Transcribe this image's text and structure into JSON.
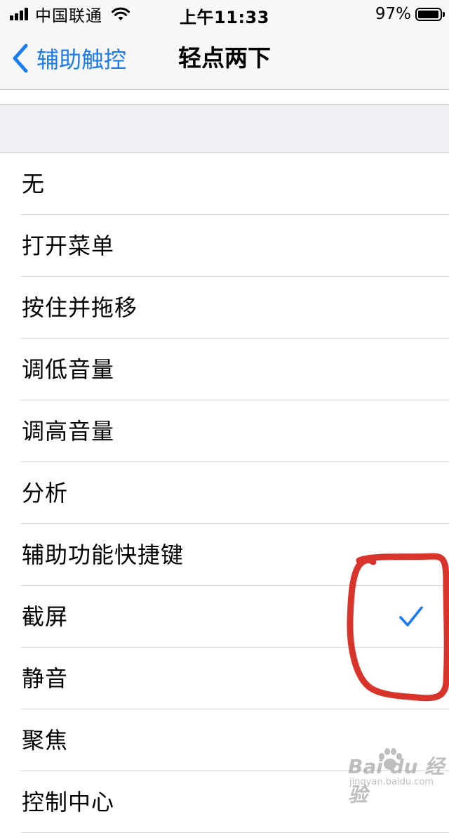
{
  "status_bar": {
    "carrier": "中国联通",
    "time": "上午11:33",
    "battery_percent": "97%",
    "battery_level": 0.97,
    "signal_bars": 4,
    "wifi_icon": "wifi-icon"
  },
  "nav": {
    "back_label": "辅助触控",
    "title": "轻点两下",
    "back_icon": "chevron-left-icon"
  },
  "options": [
    {
      "label": "无",
      "selected": false
    },
    {
      "label": "打开菜单",
      "selected": false
    },
    {
      "label": "按住并拖移",
      "selected": false
    },
    {
      "label": "调低音量",
      "selected": false
    },
    {
      "label": "调高音量",
      "selected": false
    },
    {
      "label": "分析",
      "selected": false
    },
    {
      "label": "辅助功能快捷键",
      "selected": false
    },
    {
      "label": "截屏",
      "selected": true
    },
    {
      "label": "静音",
      "selected": false
    },
    {
      "label": "聚焦",
      "selected": false
    },
    {
      "label": "控制中心",
      "selected": false
    }
  ],
  "selected_icon": "checkmark-icon",
  "watermark": {
    "main": "Bai du 经验",
    "sub": "jingyan.baidu.com"
  },
  "colors": {
    "accent": "#1a7cf2",
    "annotation": "#d9342b",
    "nav_background": "#f7f7f7",
    "group_background": "#efeff4",
    "separator": "#d1d1d6"
  }
}
